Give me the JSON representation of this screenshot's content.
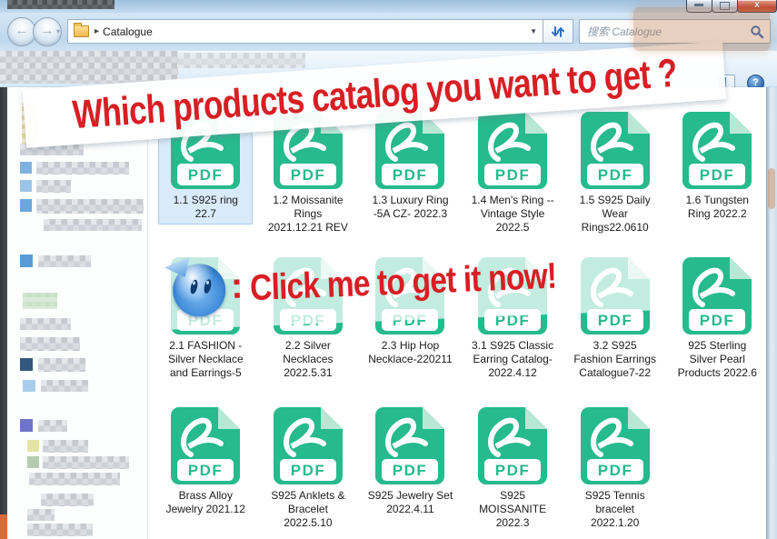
{
  "window": {
    "close_glyph": "x"
  },
  "nav": {
    "address": "Catalogue",
    "search_placeholder": "搜索 Catalogue"
  },
  "toolbar": {
    "help_glyph": "?"
  },
  "overlays": {
    "question_banner": "Which products catalog you want to get ?",
    "cta_colon": ":",
    "cta_banner": "Click me to get it now!"
  },
  "icons": {
    "pdf_label": "PDF"
  },
  "colors": {
    "pdf_green": "#26ba8c",
    "banner_red": "#d71f24",
    "selection_blue": "#d9ebfb"
  },
  "files": {
    "row1": [
      {
        "name": "1.1 S925 ring 22.7",
        "selected": true
      },
      {
        "name": "1.2 Moissanite Rings 2021.12.21 REV"
      },
      {
        "name": "1.3 Luxury Ring -5A CZ- 2022.3"
      },
      {
        "name": "1.4 Men's Ring -- Vintage Style 2022.5"
      },
      {
        "name": "1.5 S925 Daily Wear Rings22.0610"
      },
      {
        "name": "1.6 Tungsten Ring 2022.2"
      }
    ],
    "row2": [
      {
        "name": "2.1 FASHION - Silver Necklace and Earrings-5"
      },
      {
        "name": "2.2 Silver Necklaces 2022.5.31"
      },
      {
        "name": "2.3 Hip Hop Necklace-220211"
      },
      {
        "name": "3.1 S925 Classic Earring Catalog-2022.4.12"
      },
      {
        "name": "3.2 S925 Fashion Earrings Catalogue7-22"
      },
      {
        "name": "925 Sterling Silver Pearl Products 2022.6"
      }
    ],
    "row3": [
      {
        "name": "Brass Alloy Jewelry 2021.12"
      },
      {
        "name": "S925 Anklets & Bracelet 2022.5.10"
      },
      {
        "name": "S925 Jewelry Set 2022.4.11"
      },
      {
        "name": "S925 MOISSANITE 2022.3"
      },
      {
        "name": "S925 Tennis bracelet 2022.1.20"
      }
    ]
  }
}
